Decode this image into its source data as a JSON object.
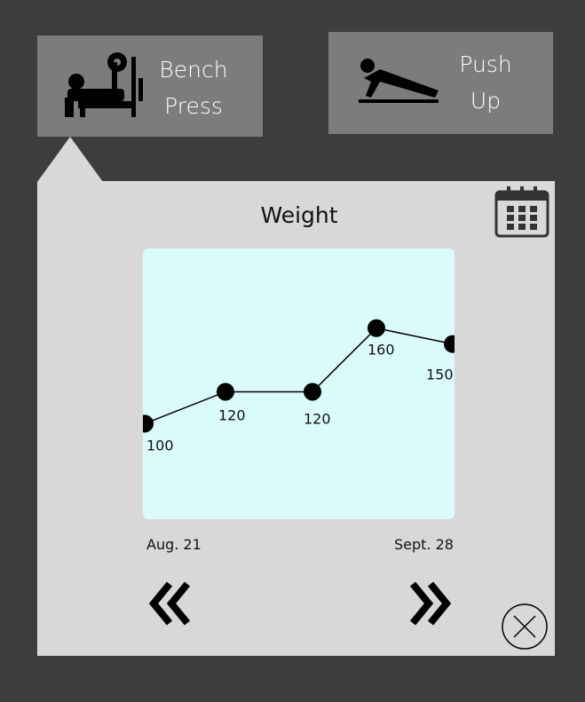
{
  "exercises": [
    {
      "label_line1": "Bench",
      "label_line2": "Press",
      "icon": "bench-press-icon",
      "selected": true
    },
    {
      "label_line1": "Push",
      "label_line2": "Up",
      "icon": "push-up-icon",
      "selected": false
    }
  ],
  "panel": {
    "title": "Weight",
    "calendar_icon": "calendar-icon",
    "close_icon": "close-circle-icon",
    "prev_icon": "double-chevron-left-icon",
    "next_icon": "double-chevron-right-icon"
  },
  "chart_data": {
    "type": "line",
    "y": [
      100,
      120,
      120,
      160,
      150
    ],
    "data_labels": [
      "100",
      "120",
      "120",
      "160",
      "150"
    ],
    "x_start_label": "Aug. 21",
    "x_end_label": "Sept. 28",
    "ylim": [
      40,
      210
    ]
  },
  "colors": {
    "background": "#3d3d3d",
    "tile": "#7c7c7c",
    "panel": "#d8d8d8",
    "plot_background": "#dbfafa",
    "marker": "#000000"
  }
}
